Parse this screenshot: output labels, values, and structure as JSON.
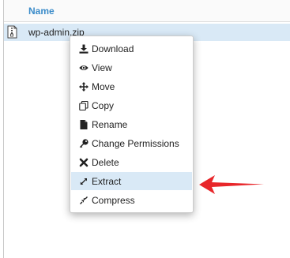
{
  "table": {
    "column_header": "Name"
  },
  "file": {
    "name": "wp-admin.zip",
    "icon": "zip-file-icon"
  },
  "context_menu": {
    "items": [
      {
        "label": "Download",
        "icon": "download-icon"
      },
      {
        "label": "View",
        "icon": "eye-icon"
      },
      {
        "label": "Move",
        "icon": "move-arrows-icon"
      },
      {
        "label": "Copy",
        "icon": "copy-icon"
      },
      {
        "label": "Rename",
        "icon": "file-icon"
      },
      {
        "label": "Change Permissions",
        "icon": "key-icon"
      },
      {
        "label": "Delete",
        "icon": "x-icon"
      },
      {
        "label": "Extract",
        "icon": "expand-icon"
      },
      {
        "label": "Compress",
        "icon": "compress-icon"
      }
    ],
    "highlighted_item": "Extract"
  },
  "annotation": {
    "arrow_color": "#e8262a"
  },
  "colors": {
    "accent": "#3a8bc9",
    "row_highlight": "#d9e9f6"
  }
}
